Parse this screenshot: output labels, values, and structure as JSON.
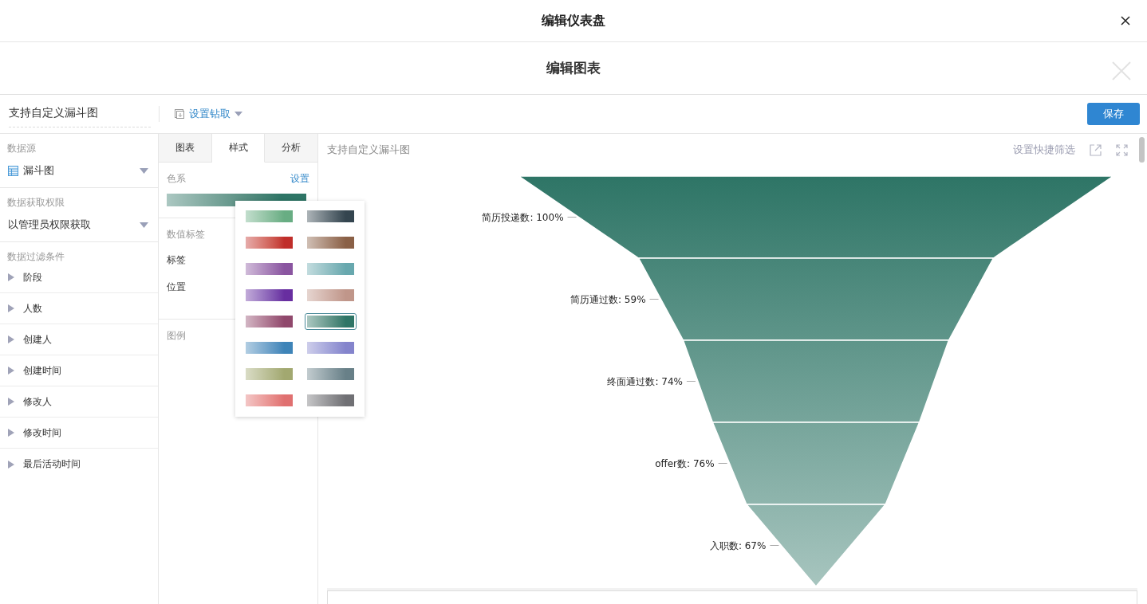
{
  "dialog": {
    "title": "编辑仪表盘"
  },
  "editor": {
    "title": "编辑图表"
  },
  "toolbar": {
    "chart_name": "支持自定义漏斗图",
    "drill_button": "设置钻取",
    "save_button": "保存"
  },
  "sidebar": {
    "data_source_label": "数据源",
    "data_source": "漏斗图",
    "permission_label": "数据获取权限",
    "permission": "以管理员权限获取",
    "filter_label": "数据过滤条件",
    "filters": [
      {
        "label": "阶段",
        "expanded": false
      },
      {
        "label": "人数",
        "expanded": false
      },
      {
        "label": "创建人",
        "expanded": false
      },
      {
        "label": "创建时间",
        "expanded": false
      },
      {
        "label": "修改人",
        "expanded": false
      },
      {
        "label": "修改时间",
        "expanded": false
      },
      {
        "label": "最后活动时间",
        "expanded": false
      }
    ]
  },
  "style_panel": {
    "tabs": [
      {
        "label": "图表",
        "selected": false
      },
      {
        "label": "样式",
        "selected": true
      },
      {
        "label": "分析",
        "selected": false
      }
    ],
    "color_scheme_label": "色系",
    "color_scheme_link": "设置",
    "value_labels_heading": "数值标签",
    "label_row": "标签",
    "position_row": "位置",
    "legend_heading": "图例"
  },
  "palette_popover": {
    "palettes": [
      {
        "color": "#68ad83",
        "selected": false
      },
      {
        "color": "#34454f",
        "selected": false
      },
      {
        "color": "#c02e2a",
        "selected": false
      },
      {
        "color": "#8a6046",
        "selected": false
      },
      {
        "color": "#8a55a0",
        "selected": false
      },
      {
        "color": "#68a8ae",
        "selected": false
      },
      {
        "color": "#682ea0",
        "selected": false
      },
      {
        "color": "#c0968a",
        "selected": false
      },
      {
        "color": "#90486c",
        "selected": false
      },
      {
        "color": "#2e7566",
        "selected": true
      },
      {
        "color": "#3e84b8",
        "selected": false
      },
      {
        "color": "#8484cc",
        "selected": false
      },
      {
        "color": "#a2a870",
        "selected": false
      },
      {
        "color": "#688088",
        "selected": false
      },
      {
        "color": "#e07070",
        "selected": false
      },
      {
        "color": "#707074",
        "selected": false
      }
    ]
  },
  "chart": {
    "title": "支持自定义漏斗图",
    "quick_filter_link": "设置快捷筛选",
    "stages": [
      {
        "label": "简历投递数: 100%"
      },
      {
        "label": "简历通过数: 59%"
      },
      {
        "label": "终面通过数: 74%"
      },
      {
        "label": "offer数: 76%"
      },
      {
        "label": "入职数: 67%"
      }
    ]
  }
}
